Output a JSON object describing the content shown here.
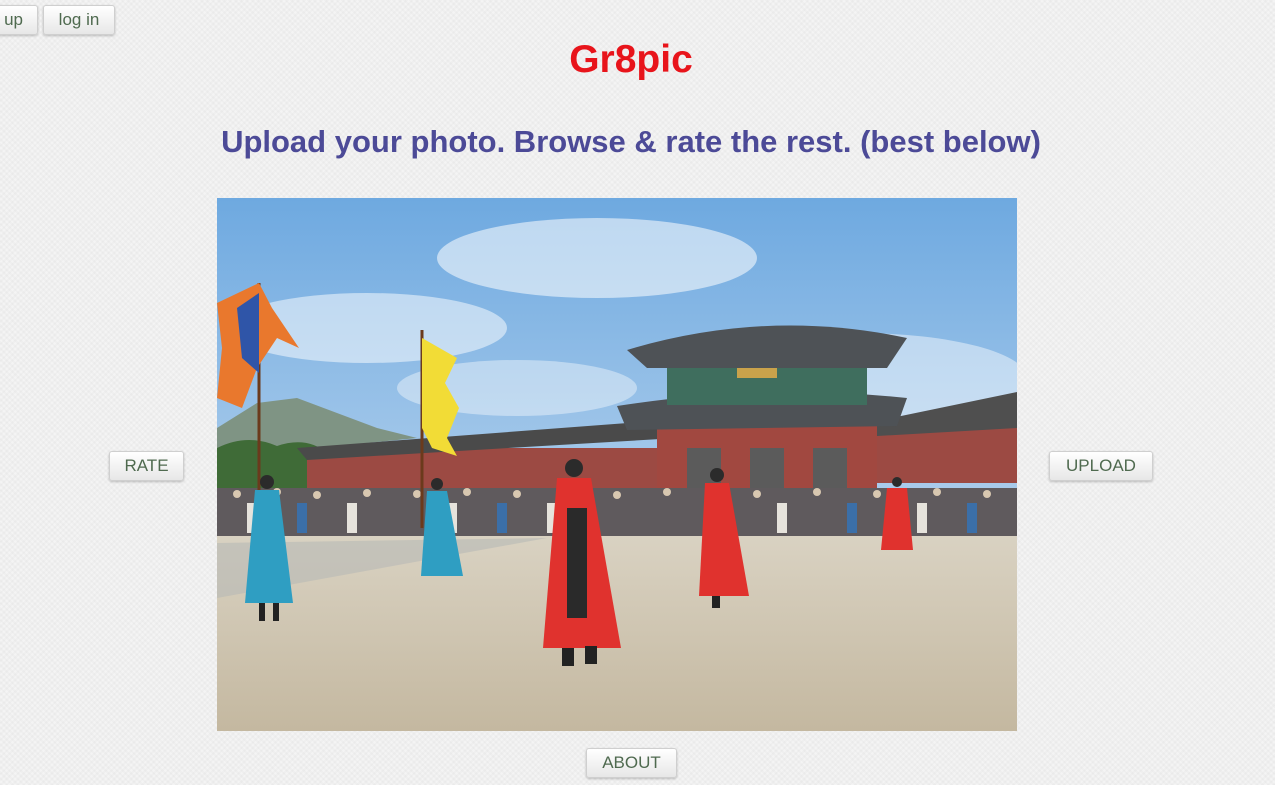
{
  "header": {
    "signup_label": "up",
    "login_label": "log in"
  },
  "site": {
    "title": "Gr8pic",
    "title_color": "#e8141b",
    "tagline": "Upload your photo. Browse & rate the rest. (best below)",
    "tagline_color": "#4c4a97"
  },
  "actions": {
    "rate_label": "RATE",
    "upload_label": "UPLOAD",
    "about_label": "ABOUT"
  },
  "photo": {
    "subject": "palace-guard-ceremony"
  }
}
